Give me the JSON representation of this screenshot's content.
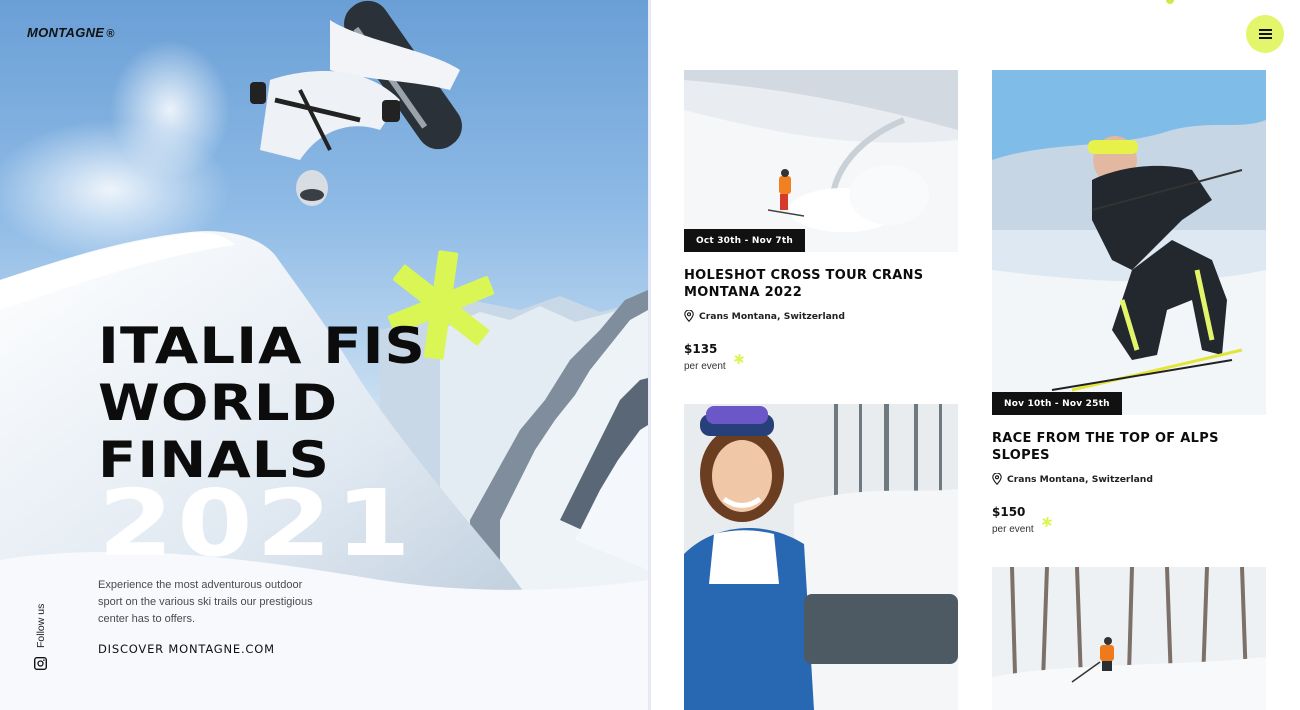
{
  "brand": {
    "name": "MONTAGNE",
    "reg": "®"
  },
  "hero": {
    "title": "ITALIA FIS\nWORLD\nFINALS",
    "year": "2021",
    "description": "Experience the most adventurous outdoor sport on the various ski trails our prestigious center has to offers.",
    "cta": "DISCOVER MONTAGNE.COM",
    "follow_label": "Follow us"
  },
  "colors": {
    "accent": "#e3f56b",
    "asterisk": "#d9f654",
    "badge_bg": "#111111",
    "text": "#0c0c0c"
  },
  "events": [
    {
      "date": "Oct 30th - Nov 7th",
      "title": "HOLESHOT CROSS TOUR CRANS MONTANA 2022",
      "location": "Crans Montana, Switzerland",
      "price": "$135",
      "price_unit": "per event"
    },
    {
      "date": "Nov 10th - Nov 25th",
      "title": "RACE FROM THE TOP OF ALPS SLOPES",
      "location": "Crans Montana, Switzerland",
      "price": "$150",
      "price_unit": "per event"
    }
  ],
  "icons": {
    "menu": "hamburger-icon",
    "location": "map-pin-icon",
    "social": "instagram-icon",
    "decor": "asterisk-icon"
  }
}
